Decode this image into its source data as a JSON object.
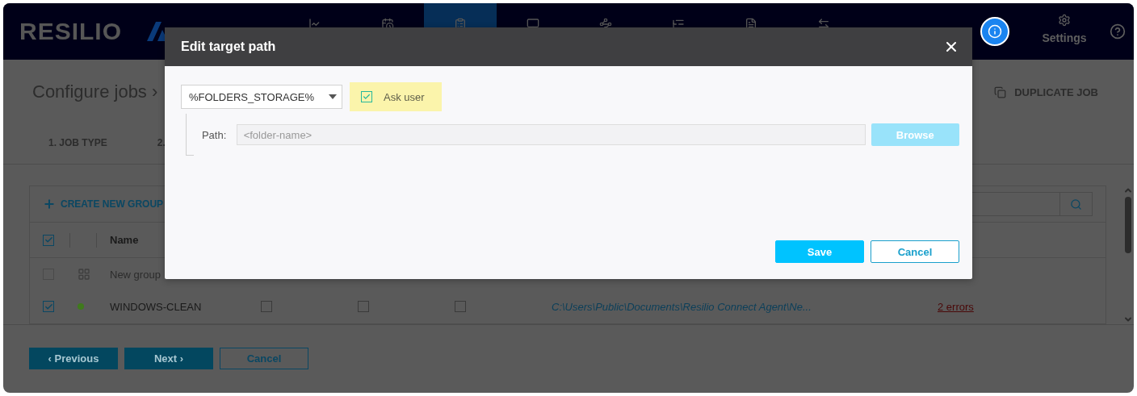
{
  "nav": {
    "logo": "RESILIO",
    "items": [
      {
        "selected": false
      },
      {
        "selected": false
      },
      {
        "selected": true
      },
      {
        "selected": false
      },
      {
        "selected": false
      },
      {
        "selected": false
      },
      {
        "selected": false
      },
      {
        "selected": false
      }
    ],
    "settings": "Settings"
  },
  "page": {
    "title": "Configure jobs ›",
    "duplicate": "DUPLICATE JOB",
    "steps": [
      "1. JOB TYPE",
      "2."
    ]
  },
  "table": {
    "create": "CREATE NEW GROUP",
    "header_checked": true,
    "columns": [
      "Name"
    ],
    "rows": [
      {
        "kind": "group",
        "checked": false,
        "disabled": true,
        "name": "New group"
      },
      {
        "kind": "agent",
        "checked": true,
        "color": "#3f7a1c",
        "name": "WINDOWS-CLEAN",
        "options": [
          false,
          false,
          false
        ],
        "path": "C:\\Users\\Public\\Documents\\Resilio Connect Agent\\Ne...",
        "errors": "2 errors"
      }
    ]
  },
  "footer": {
    "buttons": [
      {
        "label": "‹ Previous",
        "kind": "primary"
      },
      {
        "label": "Next ›",
        "kind": "primary"
      },
      {
        "label": "Cancel",
        "kind": "secondary"
      }
    ]
  },
  "dialog": {
    "title": "Edit target path",
    "storage": "%FOLDERS_STORAGE%",
    "ask_user": {
      "label": "Ask user",
      "checked": true
    },
    "path_label": "Path:",
    "path_placeholder": "<folder-name>",
    "browse": {
      "label": "Browse",
      "disabled": true
    },
    "buttons": [
      {
        "label": "Save",
        "kind": "primary"
      },
      {
        "label": "Cancel",
        "kind": "secondary"
      }
    ]
  }
}
